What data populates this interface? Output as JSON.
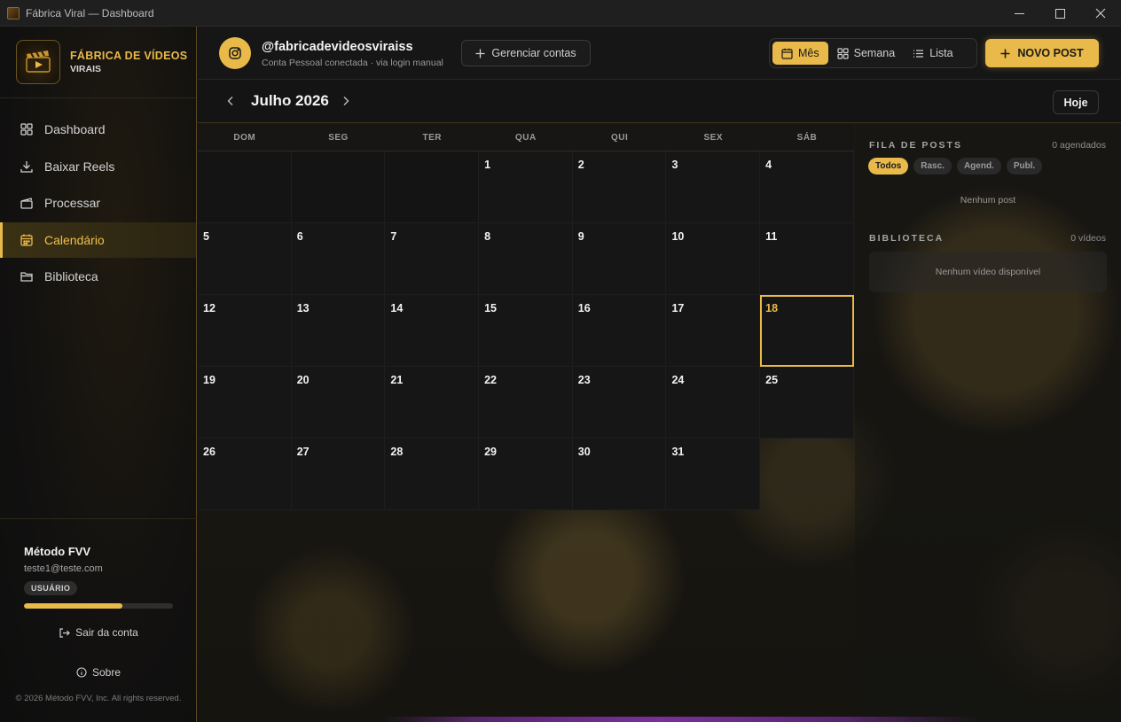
{
  "window": {
    "title": "Fábrica Viral — Dashboard"
  },
  "brand": {
    "line1": "FÁBRICA DE VÍDEOS",
    "line2": "VIRAIS"
  },
  "nav": [
    {
      "label": "Dashboard",
      "icon": "grid-icon"
    },
    {
      "label": "Baixar Reels",
      "icon": "download-icon"
    },
    {
      "label": "Processar",
      "icon": "clapperboard-icon"
    },
    {
      "label": "Calendário",
      "icon": "calendar-icon",
      "active": true
    },
    {
      "label": "Biblioteca",
      "icon": "folder-icon"
    }
  ],
  "user": {
    "name": "Método FVV",
    "email": "teste1@teste.com",
    "role": "USUÁRIO",
    "usage_fraction": 0.66,
    "logout": "Sair da conta"
  },
  "about": "Sobre",
  "copyright": "© 2026 Método FVV, Inc. All rights reserved.",
  "account": {
    "handle": "@fabricadevideosviraiss",
    "status": "Conta Pessoal conectada · via login manual",
    "manage_label": "Gerenciar contas"
  },
  "views": {
    "month": "Mês",
    "week": "Semana",
    "list": "Lista"
  },
  "new_post": "NOVO POST",
  "calendar": {
    "month_label": "Julho 2026",
    "today_label": "Hoje",
    "weekdays": [
      "DOM",
      "SEG",
      "TER",
      "QUA",
      "QUI",
      "SEX",
      "SÁB"
    ],
    "weeks": [
      [
        "",
        "",
        "",
        "1",
        "2",
        "3",
        "4"
      ],
      [
        "5",
        "6",
        "7",
        "8",
        "9",
        "10",
        "11"
      ],
      [
        "12",
        "13",
        "14",
        "15",
        "16",
        "17",
        "18"
      ],
      [
        "19",
        "20",
        "21",
        "22",
        "23",
        "24",
        "25"
      ],
      [
        "26",
        "27",
        "28",
        "29",
        "30",
        "31",
        ""
      ]
    ],
    "today": "18"
  },
  "queue": {
    "title": "FILA DE POSTS",
    "count": "0 agendados",
    "filters": [
      "Todos",
      "Rasc.",
      "Agend.",
      "Publ."
    ],
    "empty": "Nenhum post"
  },
  "library": {
    "title": "BIBLIOTECA",
    "count": "0 vídeos",
    "empty": "Nenhum vídeo disponível"
  },
  "colors": {
    "accent": "#e9b949",
    "background": "#141414"
  }
}
